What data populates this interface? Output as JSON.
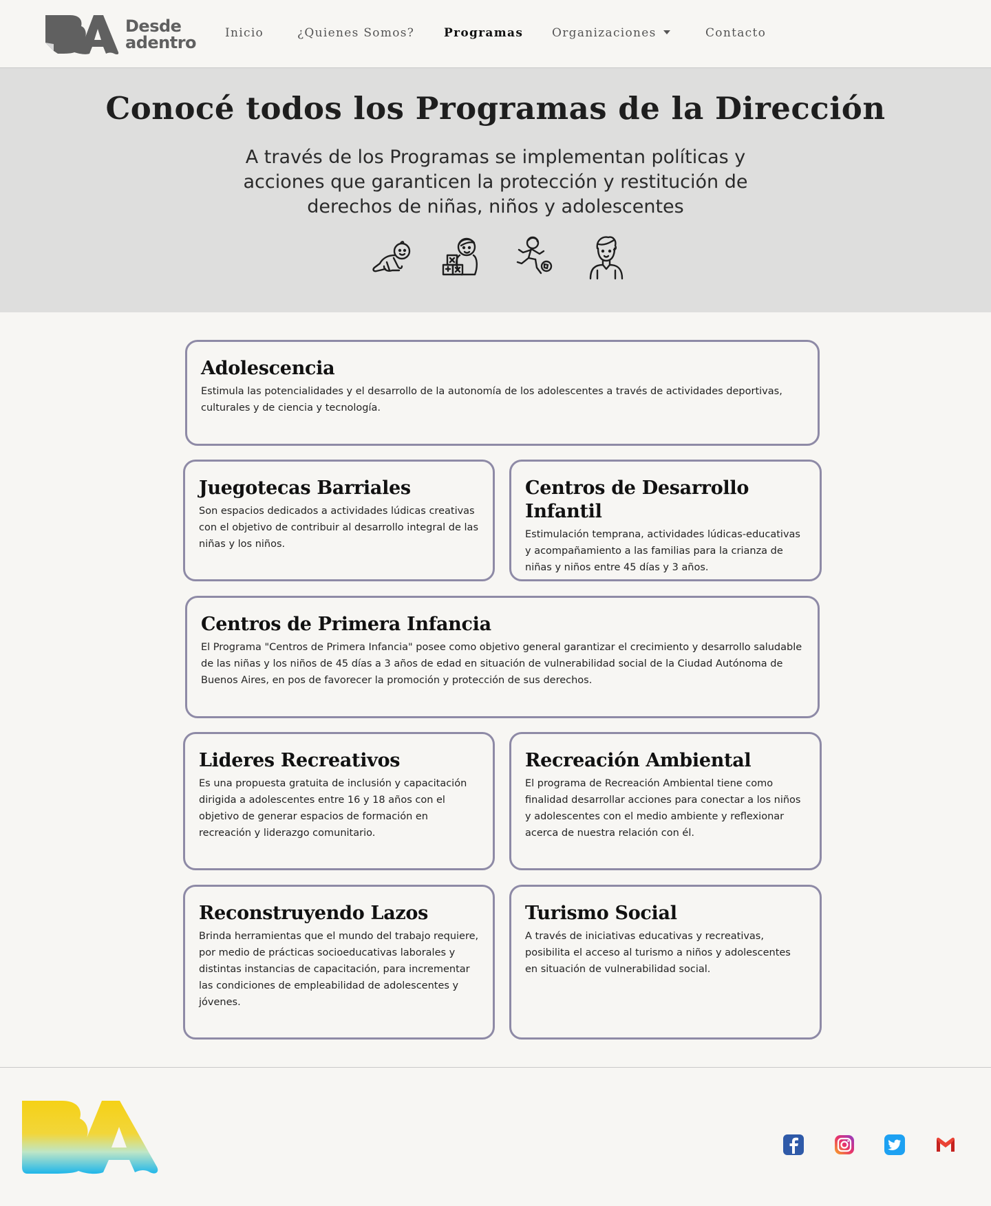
{
  "nav": {
    "brand_line1": "Desde",
    "brand_line2": "adentro",
    "links": [
      {
        "label": "Inicio"
      },
      {
        "label": "¿Quienes Somos?"
      },
      {
        "label": "Programas"
      },
      {
        "label": "Organizaciones"
      },
      {
        "label": "Contacto"
      }
    ]
  },
  "hero": {
    "title": "Conocé todos los Programas de la Dirección",
    "subtitle": "A través de los Programas se implementan políticas y acciones que garanticen la protección y restitución de derechos de niñas, niños y adolescentes",
    "icons": [
      "baby-crawling-icon",
      "child-playing-blocks-icon",
      "kid-playing-soccer-icon",
      "teenager-icon"
    ]
  },
  "programs": [
    {
      "title": "Adolescencia",
      "text": "Estimula las potencialidades y el desarrollo de la autonomía de los adolescentes a través de actividades deportivas, culturales y de ciencia y tecnología."
    },
    {
      "title": "Juegotecas Barriales",
      "text": "Son espacios dedicados a actividades lúdicas creativas con el objetivo de contribuir al desarrollo integral de las niñas y los niños."
    },
    {
      "title": "Centros de Desarrollo Infantil",
      "text": "Estimulación temprana, actividades lúdicas-educativas y acompañamiento a las familias para la crianza de niñas y niños entre 45 días y 3 años."
    },
    {
      "title": "Centros de Primera Infancia",
      "text": "El Programa \"Centros de Primera Infancia\" posee como objetivo general garantizar el crecimiento y desarrollo saludable de las niñas y los niños de 45 días a 3 años de edad en situación de vulnerabilidad social de la Ciudad Autónoma de Buenos Aires, en pos de favorecer la promoción y protección de sus derechos."
    },
    {
      "title": "Lideres Recreativos",
      "text": "Es una propuesta gratuita de inclusión y capacitación dirigida a adolescentes entre 16 y 18 años con el objetivo de generar espacios de formación en recreación y liderazgo comunitario."
    },
    {
      "title": "Recreación Ambiental",
      "text": "El programa de Recreación Ambiental tiene como finalidad desarrollar acciones para conectar a los niños y adolescentes con el medio ambiente y reflexionar acerca de nuestra relación con él."
    },
    {
      "title": "Reconstruyendo Lazos",
      "text": "Brinda herramientas que el mundo del trabajo requiere, por medio de prácticas socioeducativas laborales y distintas instancias de capacitación, para incrementar las condiciones de empleabilidad de adolescentes y jóvenes."
    },
    {
      "title": "Turismo Social",
      "text": "A través de iniciativas educativas y recreativas, posibilita el acceso al turismo a niños y adolescentes en situación de vulnerabilidad social."
    }
  ],
  "footer": {
    "logo_text": "BA",
    "social": [
      "facebook-icon",
      "instagram-icon",
      "twitter-icon",
      "gmail-icon"
    ]
  },
  "colors": {
    "background": "#f7f6f3",
    "hero_background": "#dededd",
    "card_border": "#8e8aa6",
    "brand_gray": "#606060"
  }
}
